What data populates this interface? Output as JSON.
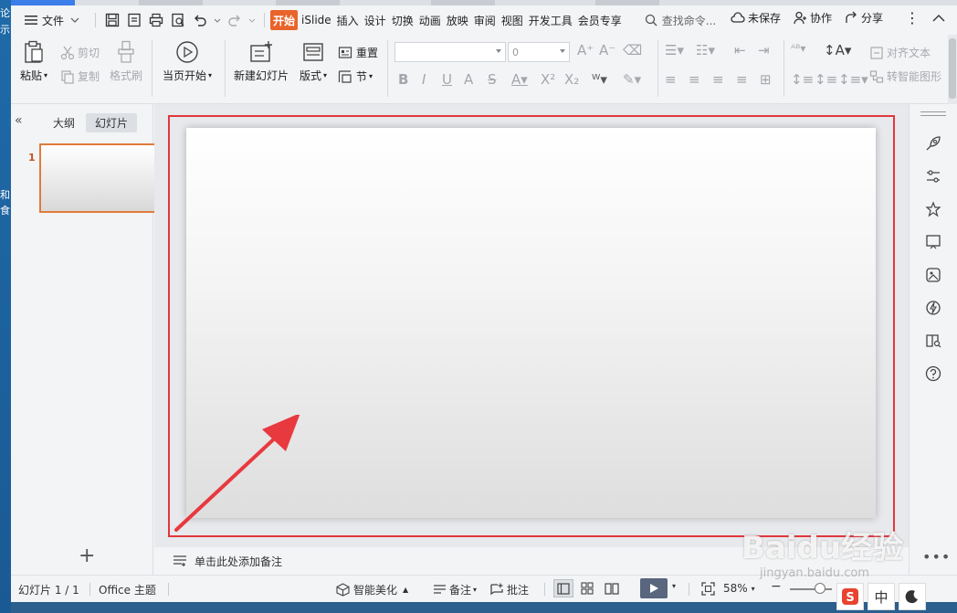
{
  "menubar": {
    "file_label": "文件",
    "tabs": [
      {
        "label": "开始",
        "active": true
      },
      {
        "label": "iSlide"
      },
      {
        "label": "插入"
      },
      {
        "label": "设计"
      },
      {
        "label": "切换"
      },
      {
        "label": "动画"
      },
      {
        "label": "放映"
      },
      {
        "label": "审阅"
      },
      {
        "label": "视图"
      },
      {
        "label": "开发工具"
      },
      {
        "label": "会员专享"
      }
    ],
    "search_placeholder": "查找命令...",
    "unsaved": "未保存",
    "collab": "协作",
    "share": "分享"
  },
  "ribbon": {
    "paste": "粘贴",
    "cut": "剪切",
    "copy": "复制",
    "format_painter": "格式刷",
    "from_current": "当页开始",
    "new_slide": "新建幻灯片",
    "layout": "版式",
    "reset": "重置",
    "section": "节",
    "font_size": "0",
    "align_text": "对齐文本",
    "smart_graphic": "转智能图形"
  },
  "left_panel": {
    "outline_tab": "大纲",
    "slides_tab": "幻灯片",
    "slide_number": "1"
  },
  "notes": {
    "placeholder": "单击此处添加备注"
  },
  "statusbar": {
    "slide_info": "幻灯片 1 / 1",
    "theme": "Office 主题",
    "smart_beautify": "智能美化",
    "notes": "备注",
    "comments": "批注",
    "zoom": "58%"
  },
  "ime": {
    "chinese": "中"
  },
  "desktop": {
    "edge_texts": [
      "论",
      "示",
      "和",
      "食"
    ]
  },
  "watermark": {
    "main": "Baidu经验",
    "sub": "jingyan.baidu.com"
  },
  "colors": {
    "accent_tab": "#e8642c",
    "highlight_border": "#e0373d",
    "arrow": "#e8393f",
    "thumb_border": "#e07b3a"
  }
}
